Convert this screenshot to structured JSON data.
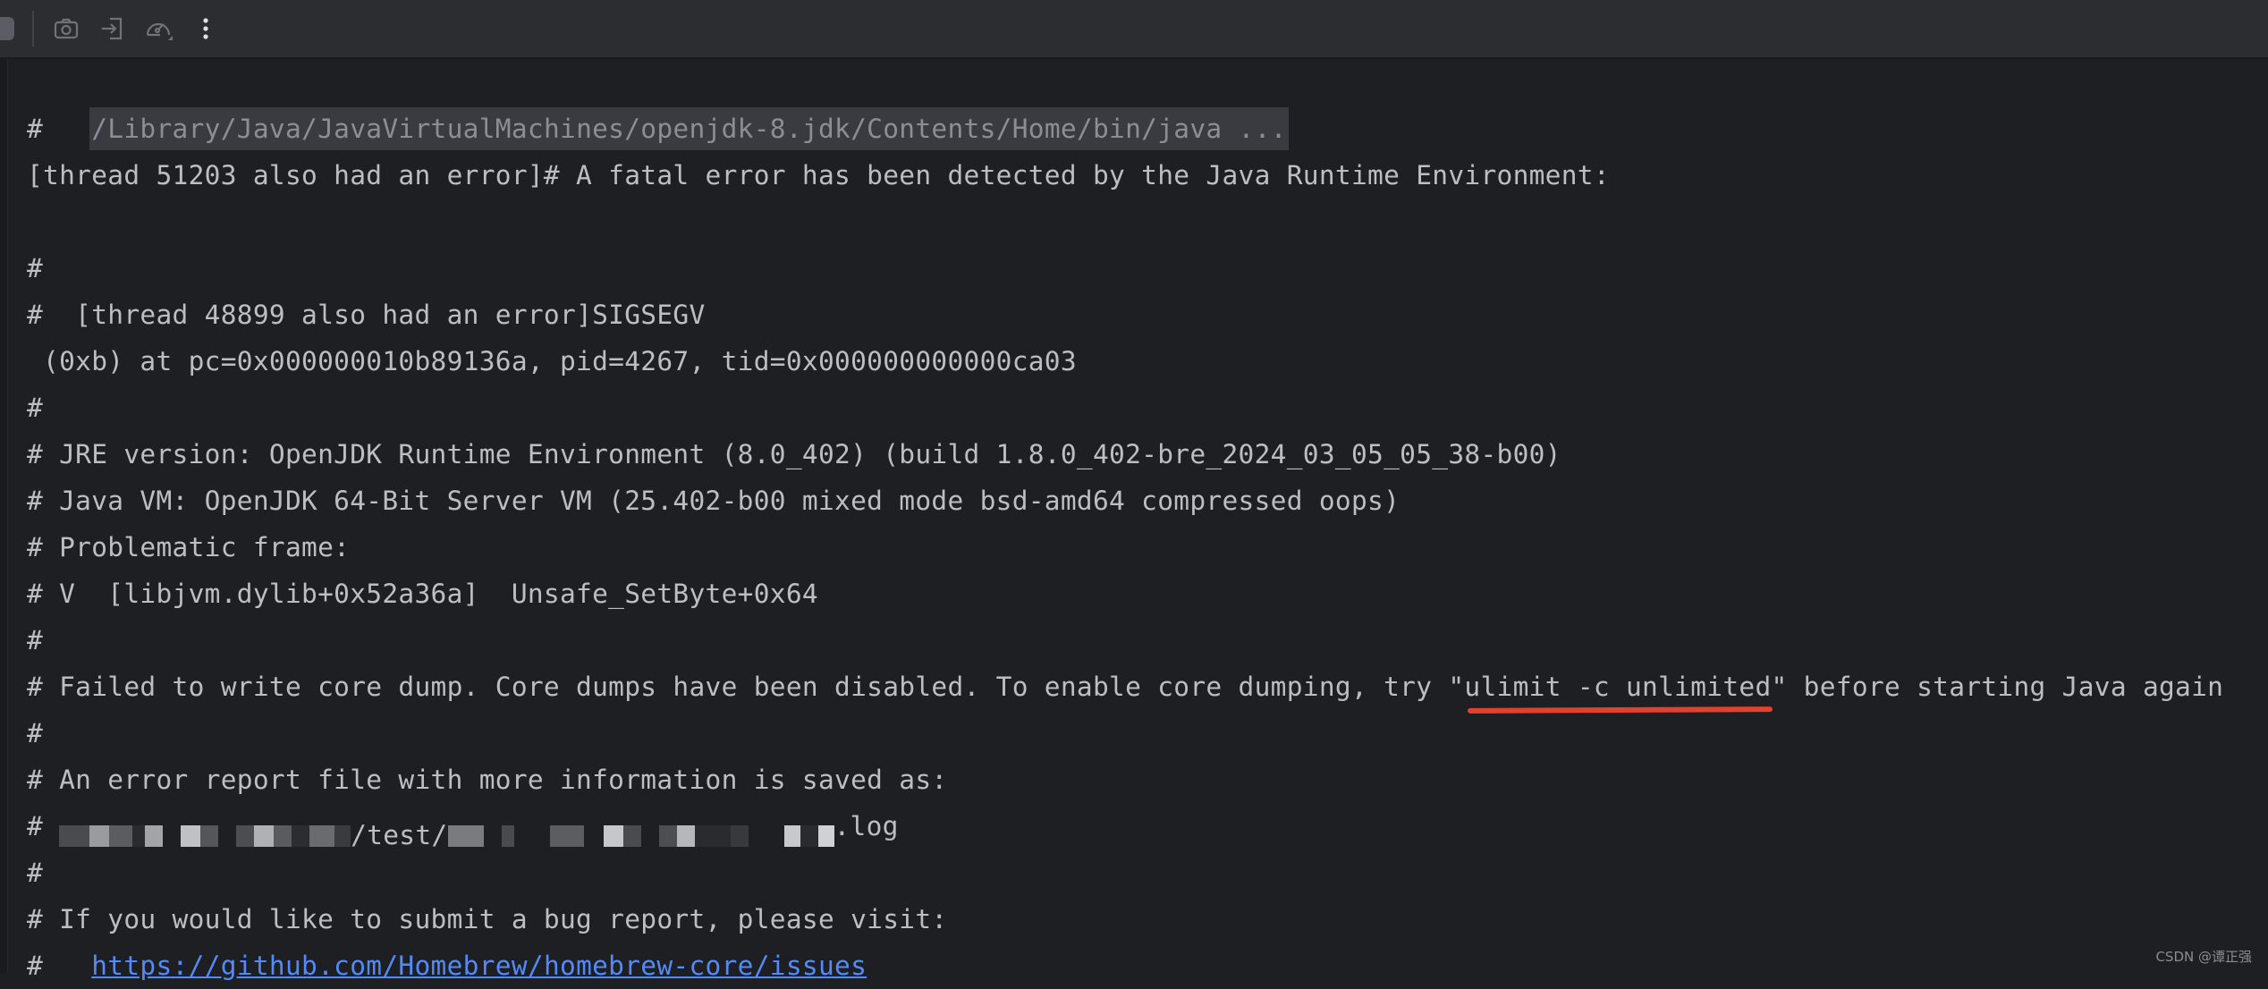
{
  "toolbar": {
    "buttons": [
      {
        "icon": "camera-icon",
        "label": "Screenshot"
      },
      {
        "icon": "login-icon",
        "label": "Attach"
      },
      {
        "icon": "speedometer-icon",
        "label": "Profiler"
      },
      {
        "icon": "more-vertical-icon",
        "label": "More"
      }
    ]
  },
  "console": {
    "command": "/Library/Java/JavaVirtualMachines/openjdk-8.jdk/Contents/Home/bin/java ...",
    "lines": [
      "#",
      "[thread 51203 also had an error]# A fatal error has been detected by the Java Runtime Environment:",
      "",
      "#",
      "#  [thread 48899 also had an error]SIGSEGV",
      " (0xb) at pc=0x000000010b89136a, pid=4267, tid=0x000000000000ca03",
      "#",
      "# JRE version: OpenJDK Runtime Environment (8.0_402) (build 1.8.0_402-bre_2024_03_05_05_38-b00)",
      "# Java VM: OpenJDK 64-Bit Server VM (25.402-b00 mixed mode bsd-amd64 compressed oops)",
      "# Problematic frame:",
      "# V  [libjvm.dylib+0x52a36a]  Unsafe_SetByte+0x64",
      "#"
    ],
    "core_dump": {
      "prefix": "# Failed to write core dump. Core dumps have been disabled. To enable core dumping, try \"",
      "highlight": "ulimit -c unlimited",
      "suffix": "\" before starting Java again"
    },
    "lines_after": [
      "#",
      "# An error report file with more information is saved as:"
    ],
    "error_file": {
      "prefix": "# ",
      "visible_fragments": "/test/",
      "suffix": ".log",
      "redacted": true
    },
    "lines_tail": [
      "#",
      "# If you would like to submit a bug report, please visit:"
    ],
    "bug_url_prefix": "#   ",
    "bug_url": "https://github.com/Homebrew/homebrew-core/issues"
  },
  "watermark": "CSDN @谭正强",
  "colors": {
    "background": "#1e1f22",
    "toolbar": "#2b2d30",
    "text": "#bcbec4",
    "link": "#548af7",
    "annotation_underline": "#e2412e"
  }
}
